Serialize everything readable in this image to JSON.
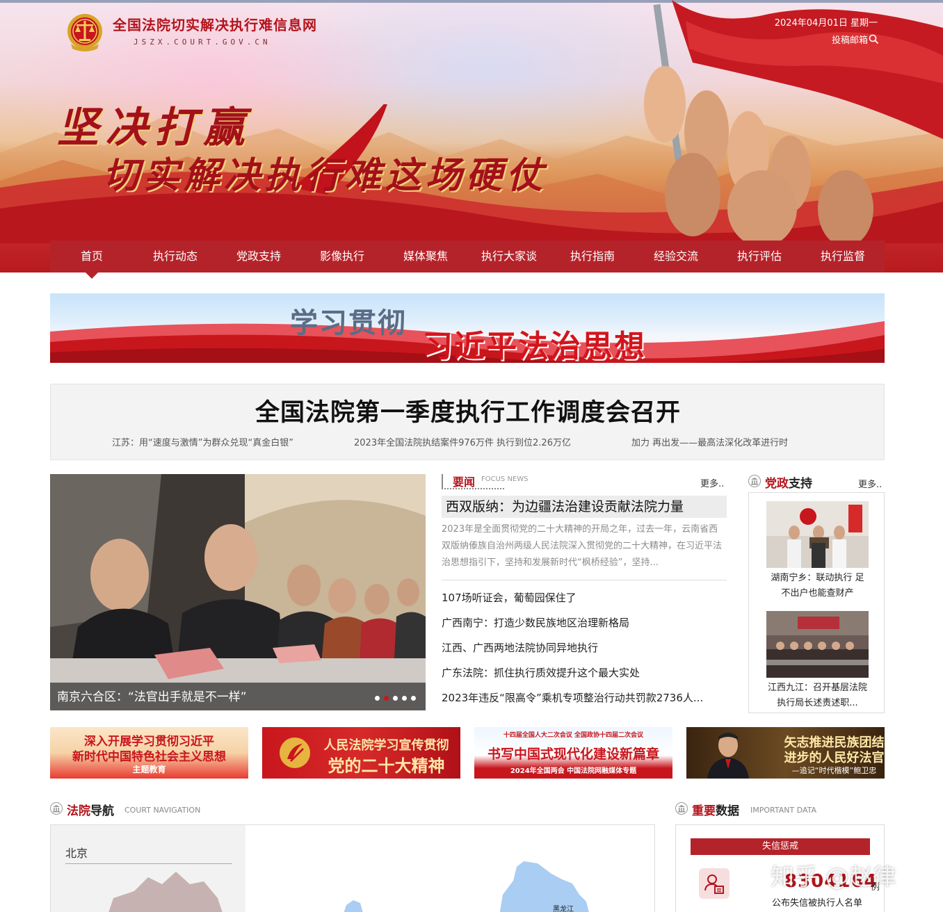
{
  "header": {
    "site_title": "全国法院切实解决执行难信息网",
    "site_domain": "JSZX.COURT.GOV.CN",
    "date": "2024年04月01日 星期一",
    "mailbox": "投稿邮箱",
    "slogan_line1": "坚决打赢",
    "slogan_line2": "切实解决执行难这场硬仗"
  },
  "nav": {
    "items": [
      {
        "label": "首页",
        "active": true
      },
      {
        "label": "执行动态"
      },
      {
        "label": "党政支持"
      },
      {
        "label": "影像执行"
      },
      {
        "label": "媒体聚焦"
      },
      {
        "label": "执行大家谈"
      },
      {
        "label": "执行指南"
      },
      {
        "label": "经验交流"
      },
      {
        "label": "执行评估"
      },
      {
        "label": "执行监督"
      }
    ]
  },
  "banner": {
    "text1": "学习贯彻",
    "text2": "习近平法治思想"
  },
  "headline": {
    "title": "全国法院第一季度执行工作调度会召开",
    "subs": [
      "江苏：用“速度与激情”为群众兑现“真金白银”",
      "2023年全国法院执结案件976万件 执行到位2.26万亿",
      "加力 再出发——最高法深化改革进行时"
    ]
  },
  "slideshow": {
    "caption": "南京六合区：“法官出手就是不一样”",
    "dot_count": 5,
    "active_dot": 2
  },
  "focus_news": {
    "title": "要闻",
    "title_en": "FOCUS NEWS",
    "more": "更多..",
    "lead_title": "西双版纳：为边疆法治建设贡献法院力量",
    "lead_summary": "2023年是全面贯彻党的二十大精神的开局之年，过去一年，云南省西双版纳傣族自治州两级人民法院深入贯彻党的二十大精神，在习近平法治思想指引下，坚持和发展新时代“枫桥经验”，坚持...",
    "items": [
      "107场听证会，葡萄园保住了",
      "广西南宁：打造少数民族地区治理新格局",
      "江西、广西两地法院协同异地执行",
      "广东法院：抓住执行质效提升这个最大实处",
      "2023年违反“限高令”乘机专项整治行动共罚款2736人..."
    ]
  },
  "party_support": {
    "title_red": "党政",
    "title_black": "支持",
    "more": "更多..",
    "cards": [
      {
        "caption": "湖南宁乡：联动执行 足不出户也能查财产"
      },
      {
        "caption": "江西九江：召开基层法院执行局长述责述职..."
      }
    ]
  },
  "promos": [
    {
      "line1": "深入开展学习贯彻习近平",
      "line2": "新时代中国特色社会主义思想",
      "line3": "主题教育"
    },
    {
      "line1": "人民法院学习宣传贯彻",
      "line2": "党的二十大精神"
    },
    {
      "line1": "十四届全国人大二次会议   全国政协十四届二次会议",
      "line2": "书写中国式现代化建设新篇章",
      "line3": "2024年全国两会    中国法院网融媒体专题"
    },
    {
      "line1": "矢志推进民族团结",
      "line2": "进步的人民好法官",
      "line3": "—追记“时代楷模”鲍卫忠"
    }
  ],
  "court_nav": {
    "title_red": "法院",
    "title_black": "导航",
    "title_en": "COURT NAVIGATION",
    "region": "北京",
    "map_label": "黑龙江"
  },
  "important_data": {
    "title_red": "重要",
    "title_black": "数据",
    "title_en": "IMPORTANT DATA",
    "tab": "失信惩戒",
    "number": "8304164",
    "unit": "例",
    "label": "公布失信被执行人名单"
  },
  "watermark": "知乎 @赵律",
  "colors": {
    "primary_red": "#b5232a",
    "title_red": "#b3141c",
    "headline_bg": "#f3f3f3"
  }
}
